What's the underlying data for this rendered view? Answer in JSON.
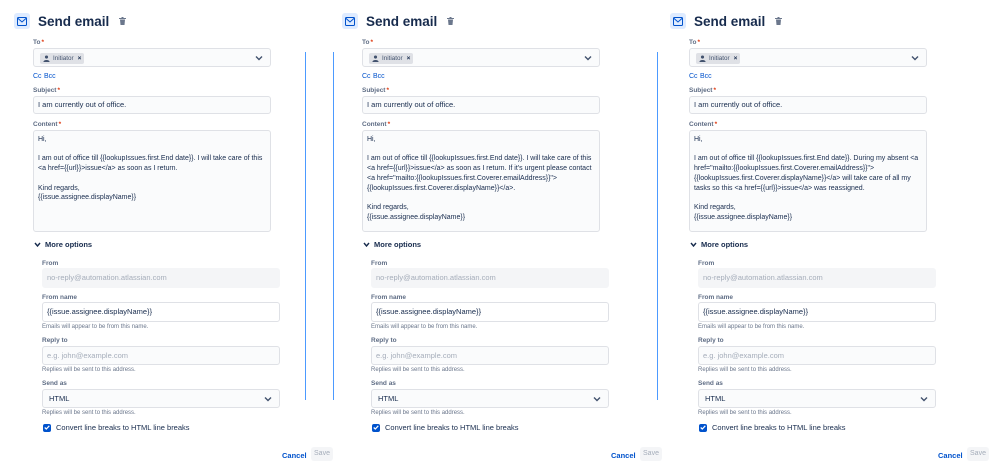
{
  "dialog": {
    "title": "Send email",
    "to_label": "To",
    "recipient_chip": "Initiator",
    "cc_label": "Cc",
    "bcc_label": "Bcc",
    "subject_label": "Subject",
    "subject_value": "I am currently out of office.",
    "content_label": "Content",
    "more_options_label": "More options",
    "from_label": "From",
    "from_value": "no-reply@automation.atlassian.com",
    "from_name_label": "From name",
    "from_name_value": "{{issue.assignee.displayName}}",
    "from_name_help": "Emails will appear to be from this name.",
    "reply_to_label": "Reply to",
    "reply_to_placeholder": "e.g. john@example.com",
    "reply_to_help": "Replies will be sent to this address.",
    "send_as_label": "Send as",
    "send_as_value": "HTML",
    "send_as_help": "Replies will be sent to this address.",
    "convert_label": "Convert line breaks to HTML line breaks",
    "cancel_label": "Cancel",
    "save_label": "Save",
    "colors": {
      "accent": "#0052cc",
      "required": "#de350b",
      "divider": "#4c9aff"
    }
  },
  "panels": [
    {
      "content": "Hi,\n\nI am out of office till {{lookupIssues.first.End date}}. I will take care of this <a href={{url}}>issue</a> as soon as I return.\n\nKind regards,\n{{issue.assignee.displayName}}"
    },
    {
      "content": "Hi,\n\nI am out of office till {{lookupIssues.first.End date}}. I will take care of this <a href={{url}}>issue</a> as soon as I return. If it's urgent please contact <a href=\"mailto:{{lookupIssues.first.Coverer.emailAddress}}\">{{lookupIssues.first.Coverer.displayName}}</a>.\n\nKind regards,\n{{issue.assignee.displayName}}"
    },
    {
      "content": "Hi,\n\nI am out of office till {{lookupIssues.first.End date}}. During my absent <a href=\"mailto:{{lookupIssues.first.Coverer.emailAddress}}\">{{lookupIssues.first.Coverer.displayName}}</a> will take care of all my tasks so this <a href={{url}}>issue</a> was reassigned.\n\nKind regards,\n{{issue.assignee.displayName}}"
    }
  ]
}
